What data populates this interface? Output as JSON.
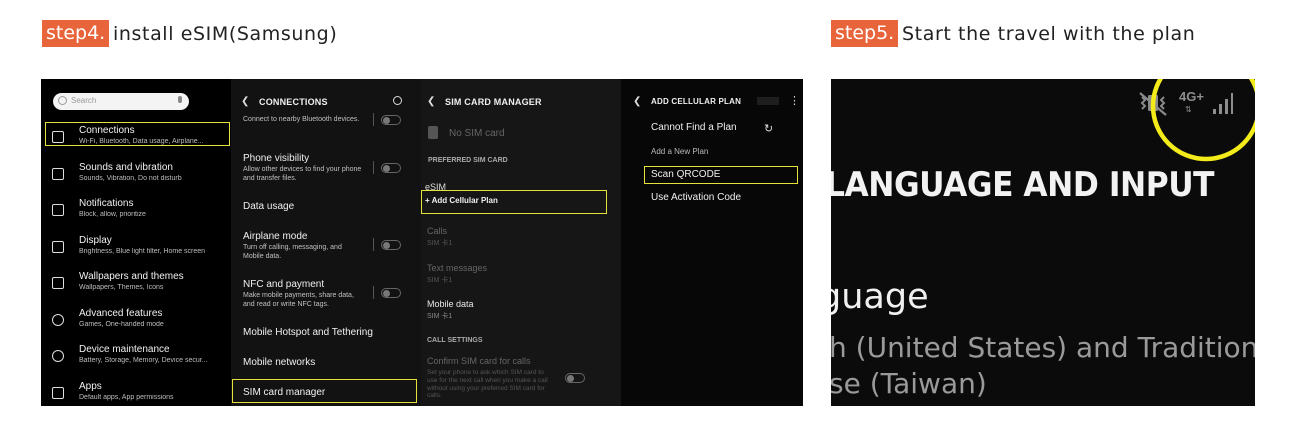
{
  "step4": {
    "badge": "step4.",
    "title": "install eSIM(Samsung)",
    "settings": {
      "search_placeholder": "Search",
      "items": [
        {
          "title": "Connections",
          "sub": "Wi-Fi, Bluetooth, Data usage, Airplane..."
        },
        {
          "title": "Sounds and vibration",
          "sub": "Sounds, Vibration, Do not disturb"
        },
        {
          "title": "Notifications",
          "sub": "Block, allow, prioritize"
        },
        {
          "title": "Display",
          "sub": "Brightness, Blue light filter, Home screen"
        },
        {
          "title": "Wallpapers and themes",
          "sub": "Wallpapers, Themes, Icons"
        },
        {
          "title": "Advanced features",
          "sub": "Games, One-handed mode"
        },
        {
          "title": "Device maintenance",
          "sub": "Battery, Storage, Memory, Device secur..."
        },
        {
          "title": "Apps",
          "sub": "Default apps, App permissions"
        }
      ]
    },
    "connections": {
      "header": "CONNECTIONS",
      "top_sub": "Connect to nearby Bluetooth devices.",
      "phone_visibility": {
        "title": "Phone visibility",
        "sub": "Allow other devices to find your phone and transfer files."
      },
      "data_usage": "Data usage",
      "airplane": {
        "title": "Airplane mode",
        "sub": "Turn off calling, messaging, and Mobile data."
      },
      "nfc": {
        "title": "NFC and payment",
        "sub": "Make mobile payments, share data, and read or write NFC tags."
      },
      "hotspot": "Mobile Hotspot and Tethering",
      "mobile_networks": "Mobile networks",
      "sim_manager": "SIM card manager"
    },
    "sim_manager": {
      "header": "SIM CARD MANAGER",
      "no_sim": "No SIM card",
      "preferred": "PREFERRED SIM CARD",
      "esim": "eSIM",
      "add_plan": "+ Add Cellular Plan",
      "calls": "Calls",
      "calls_sub": "SIM 卡1",
      "text_messages": "Text messages",
      "text_sub": "SIM 卡1",
      "mobile_data": "Mobile data",
      "data_sub": "SIM 卡1",
      "call_settings": "CALL SETTINGS",
      "confirm_title": "Confirm SIM card for calls",
      "confirm_sub": "Set your phone to ask which SIM card to use for the next call when you make a call without using your preferred SIM card for calls."
    },
    "add_plan": {
      "header": "ADD CELLULAR PLAN",
      "cannot_find": "Cannot Find a Plan",
      "add_new": "Add a New Plan",
      "scan": "Scan QRCODE",
      "activation": "Use Activation Code"
    }
  },
  "step5": {
    "badge": "step5.",
    "title": "Start the travel with the plan",
    "network": "4G+",
    "heading": "LANGUAGE AND INPUT",
    "sub_heading": "guage",
    "line1": "h (United States) and Traditional",
    "line2": "se (Taiwan)",
    "highlight_color": "#f3ec1a"
  },
  "colors": {
    "badge": "#e8643a",
    "highlight": "#e6e23a"
  }
}
